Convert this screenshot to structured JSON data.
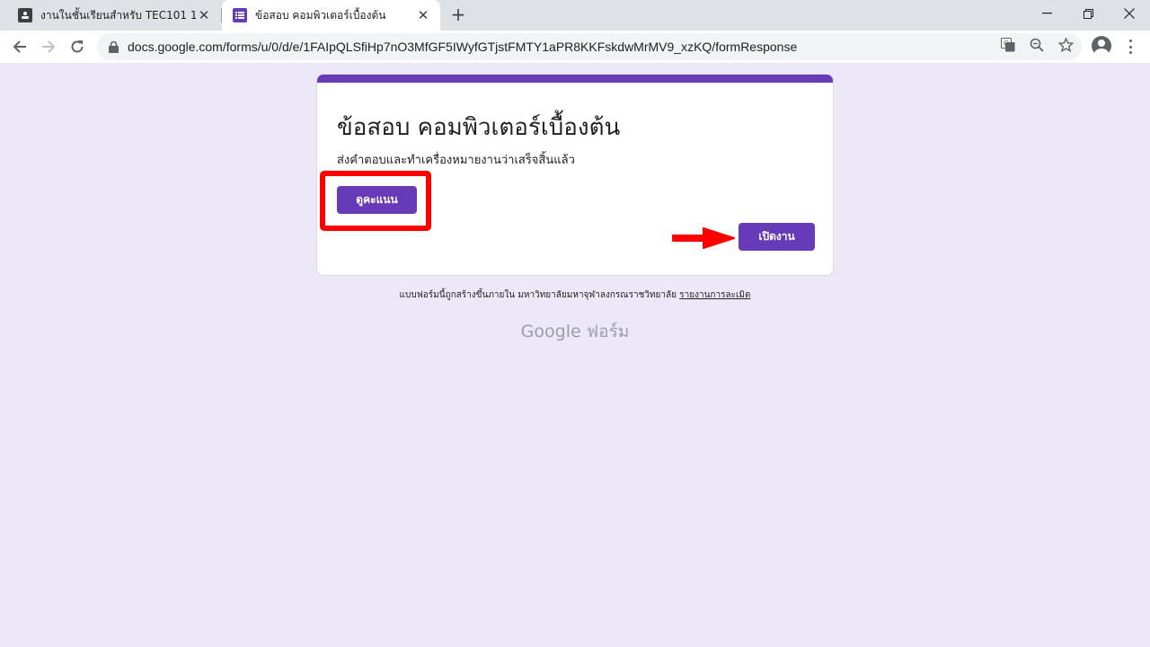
{
  "browser": {
    "tabs": [
      {
        "title": "งานในชั้นเรียนสำหรับ TEC101 1",
        "icon": "classroom-icon",
        "active": false
      },
      {
        "title": "ข้อสอบ คอมพิวเตอร์เบื้องต้น",
        "icon": "google-forms-icon",
        "active": true
      }
    ],
    "new_tab_label": "+",
    "window_controls": {
      "minimize": "—",
      "restore": "❐",
      "close": "✕"
    },
    "tab_close": "✕",
    "url": "docs.google.com/forms/u/0/d/e/1FAIpQLSfiHp7nO3MfGF5IWyfGTjstFMTY1aPR8KKFskdwMrMV9_xzKQ/formResponse"
  },
  "form": {
    "title": "ข้อสอบ คอมพิวเตอร์เบื้องต้น",
    "message": "ส่งคำตอบและทำเครื่องหมายงานว่าเสร็จสิ้นแล้ว",
    "view_score_label": "ดูคะแนน",
    "open_assignment_label": "เปิดงาน",
    "accent_color": "#673ab7"
  },
  "annotations": {
    "highlight_color": "#ff0000"
  },
  "footer": {
    "note": "แบบฟอร์มนี้ถูกสร้างขึ้นภายใน มหาวิทยาลัยมหาจุฬาลงกรณราชวิทยาลัย",
    "report_link": "รายงานการละเมิด",
    "brand": "Google ฟอร์ม"
  }
}
